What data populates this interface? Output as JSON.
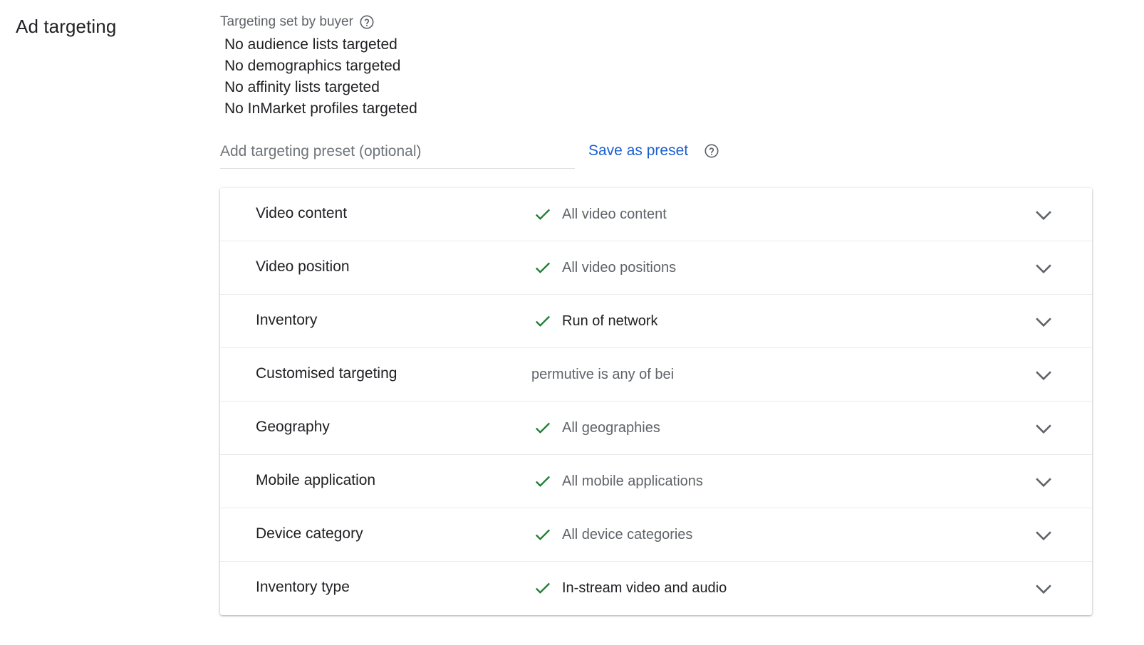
{
  "section": {
    "title": "Ad targeting"
  },
  "buyer": {
    "label": "Targeting set by buyer",
    "items": [
      "No audience lists targeted",
      "No demographics targeted",
      "No affinity lists targeted",
      "No InMarket profiles targeted"
    ]
  },
  "preset": {
    "placeholder": "Add targeting preset (optional)",
    "value": "",
    "save_label": "Save as preset"
  },
  "targeting_rows": [
    {
      "label": "Video content",
      "value": "All video content",
      "checked": true,
      "emphasis": false
    },
    {
      "label": "Video position",
      "value": "All video positions",
      "checked": true,
      "emphasis": false
    },
    {
      "label": "Inventory",
      "value": "Run of network",
      "checked": true,
      "emphasis": true
    },
    {
      "label": "Customised targeting",
      "value": "permutive is any of bei",
      "checked": false,
      "emphasis": false
    },
    {
      "label": "Geography",
      "value": "All geographies",
      "checked": true,
      "emphasis": false
    },
    {
      "label": "Mobile application",
      "value": "All mobile applications",
      "checked": true,
      "emphasis": false
    },
    {
      "label": "Device category",
      "value": "All device categories",
      "checked": true,
      "emphasis": false
    },
    {
      "label": "Inventory type",
      "value": "In-stream video and audio",
      "checked": true,
      "emphasis": true
    }
  ],
  "colors": {
    "check": "#1e7e34",
    "link": "#1a5fd1",
    "chevron": "#5f6368"
  },
  "icons": {
    "help": "help-circle-icon",
    "check": "check-icon",
    "expand": "chevron-down-icon"
  }
}
